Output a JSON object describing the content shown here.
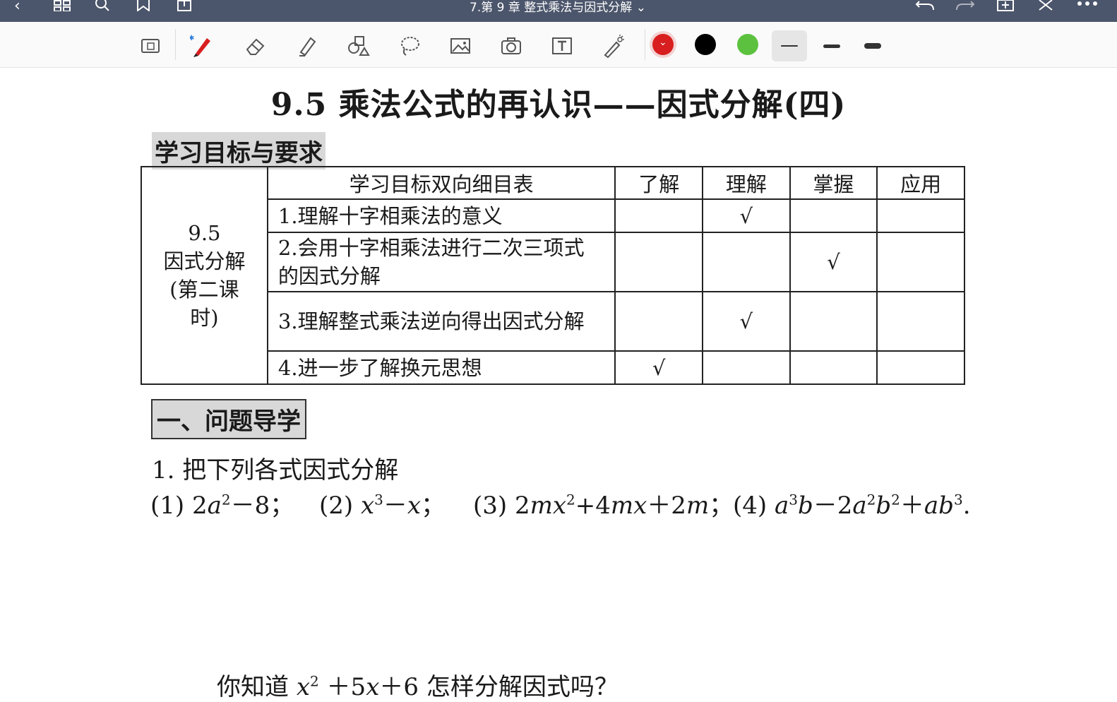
{
  "topbar": {
    "doc_title": "7.第 9 章 整式乘法与因式分解 ⌄",
    "icons": [
      "back-icon",
      "grid-icon",
      "search-icon",
      "bookmark-icon",
      "share-icon",
      "undo-icon",
      "redo-icon",
      "add-page-icon",
      "close-icon",
      "more-icon"
    ]
  },
  "toolbar": {
    "tools": [
      "keyboard-icon",
      "pen-icon",
      "eraser-icon",
      "highlighter-icon",
      "shapes-icon",
      "lasso-icon",
      "image-icon",
      "camera-icon",
      "text-icon",
      "laser-icon"
    ],
    "colors": [
      "#d81e1e",
      "#000000",
      "#5cc13e"
    ],
    "selected_color": "#d81e1e"
  },
  "document": {
    "title": "9.5  乘法公式的再认识——因式分解(四)",
    "section1": "学习目标与要求",
    "table": {
      "header_title": "学习目标双向细目表",
      "columns": [
        "了解",
        "理解",
        "掌握",
        "应用"
      ],
      "lesson_lines": [
        "9.5",
        "因式分解",
        "(第二课",
        "时)"
      ],
      "rows": [
        {
          "text": "1.理解十字相乘法的意义",
          "marks": [
            "",
            "√",
            "",
            ""
          ]
        },
        {
          "text": "2.会用十字相乘法进行二次三项式的因式分解",
          "marks": [
            "",
            "",
            "√",
            ""
          ]
        },
        {
          "text": "3.理解整式乘法逆向得出因式分解",
          "marks": [
            "",
            "√",
            "",
            ""
          ]
        },
        {
          "text": "4.进一步了解换元思想",
          "marks": [
            "√",
            "",
            "",
            ""
          ]
        }
      ]
    },
    "section2": "一、问题导学",
    "question1": "1.  把下列各式因式分解",
    "exercises": {
      "e1_label": "(1) ",
      "e1_a": "2",
      "e1_b": "a",
      "e1_c": "2",
      "e1_d": "－8；",
      "e2_label": "(2) ",
      "e2_a": "x",
      "e2_b": "3",
      "e2_c": "－",
      "e2_d": "x",
      "e2_e": "；",
      "e3_label": "(3) ",
      "e3_a": "2",
      "e3_b": "mx",
      "e3_c": "2",
      "e3_d": "+4",
      "e3_e": "mx",
      "e3_f": "＋2",
      "e3_g": "m",
      "e3_h": "；",
      "e4_label": "(4) ",
      "e4_a": "a",
      "e4_b": "3",
      "e4_c": "b",
      "e4_d": "－2",
      "e4_e": "a",
      "e4_f": "2",
      "e4_g": "b",
      "e4_h": "2",
      "e4_i": "＋",
      "e4_j": "ab",
      "e4_k": "3",
      "e4_l": "."
    },
    "question2": {
      "a": "你知道 ",
      "b": "x",
      "c": "2",
      "d": " ＋5",
      "e": "x",
      "f": "＋6 怎样分解因式吗？"
    }
  }
}
